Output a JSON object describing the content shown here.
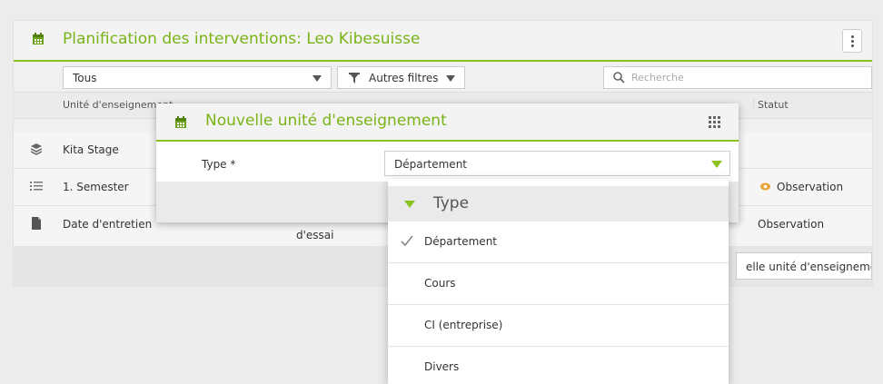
{
  "header": {
    "title": "Planification des interventions: Leo Kibesuisse"
  },
  "filters": {
    "scope_value": "Tous",
    "more_filters_label": "Autres filtres",
    "search_placeholder": "Recherche"
  },
  "columns": {
    "unit": "Unité d'enseignement",
    "status": "Statut"
  },
  "rows": [
    {
      "label": "Kita Stage",
      "icon": "layers-icon",
      "status": ""
    },
    {
      "label": "1. Semester",
      "icon": "list-icon",
      "status": "Observation"
    },
    {
      "label": "Date d'entretien",
      "icon": "document-icon",
      "extra": "d'essai",
      "status": "Observation"
    }
  ],
  "footer": {
    "add_label": "Nouvelle unité d'enseignement",
    "add_label_visible": "elle unité d'enseignement"
  },
  "modal": {
    "title": "Nouvelle unité d'enseignement",
    "type_label": "Type *",
    "type_value": "Département"
  },
  "dropdown": {
    "header": "Type",
    "options": [
      "Département",
      "Cours",
      "CI (entreprise)",
      "Divers"
    ],
    "selected": "Département"
  },
  "colors": {
    "accent": "#8cc21f",
    "accent_text": "#7ab317",
    "status_eye": "#e8a33a"
  }
}
